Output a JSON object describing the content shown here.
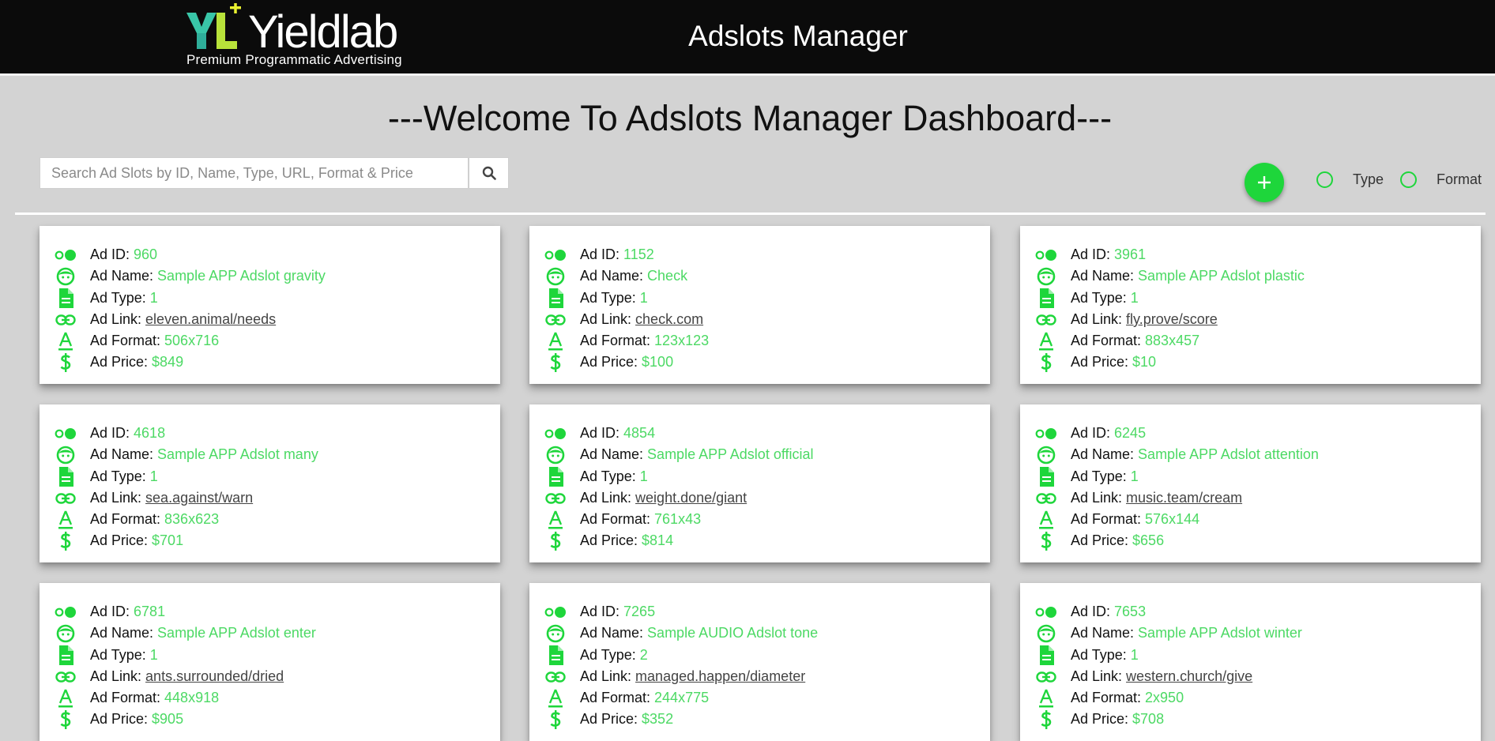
{
  "header": {
    "logo_wordmark": "Yieldlab",
    "logo_mark": "YL+",
    "logo_tagline": "Premium Programmatic Advertising",
    "title": "Adslots Manager"
  },
  "welcome_text": "---Welcome To Adslots Manager Dashboard---",
  "search": {
    "placeholder": "Search Ad Slots by ID, Name, Type, URL, Format & Price",
    "value": "",
    "icon": "search-icon"
  },
  "actions": {
    "add_label": "+",
    "add_icon": "plus-icon"
  },
  "filters": [
    {
      "label": "Type",
      "checked": false
    },
    {
      "label": "Format",
      "checked": false
    }
  ],
  "colors": {
    "accent": "#1ed63b",
    "value_text": "#4cd964",
    "header_bg": "#0b0b0b",
    "page_bg": "#d3d3d3"
  },
  "field_labels": {
    "id": "Ad ID:",
    "name": "Ad Name:",
    "type": "Ad Type:",
    "link": "Ad Link:",
    "format": "Ad Format:",
    "price": "Ad Price:"
  },
  "field_icons": {
    "id": "toggle-icon",
    "name": "face-icon",
    "type": "document-icon",
    "link": "link-icon",
    "format": "font-format-icon",
    "price": "dollar-icon"
  },
  "adslots": [
    {
      "id": "960",
      "name": "Sample APP Adslot gravity",
      "type": "1",
      "link": "eleven.animal/needs",
      "format": "506x716",
      "price": "$849"
    },
    {
      "id": "1152",
      "name": "Check",
      "type": "1",
      "link": "check.com",
      "format": "123x123",
      "price": "$100"
    },
    {
      "id": "3961",
      "name": "Sample APP Adslot plastic",
      "type": "1",
      "link": "fly.prove/score",
      "format": "883x457",
      "price": "$10"
    },
    {
      "id": "4618",
      "name": "Sample APP Adslot many",
      "type": "1",
      "link": "sea.against/warn",
      "format": "836x623",
      "price": "$701"
    },
    {
      "id": "4854",
      "name": "Sample APP Adslot official",
      "type": "1",
      "link": "weight.done/giant",
      "format": "761x43",
      "price": "$814"
    },
    {
      "id": "6245",
      "name": "Sample APP Adslot attention",
      "type": "1",
      "link": "music.team/cream",
      "format": "576x144",
      "price": "$656"
    },
    {
      "id": "6781",
      "name": "Sample APP Adslot enter",
      "type": "1",
      "link": "ants.surrounded/dried",
      "format": "448x918",
      "price": "$905"
    },
    {
      "id": "7265",
      "name": "Sample AUDIO Adslot tone",
      "type": "2",
      "link": "managed.happen/diameter",
      "format": "244x775",
      "price": "$352"
    },
    {
      "id": "7653",
      "name": "Sample APP Adslot winter",
      "type": "1",
      "link": "western.church/give",
      "format": "2x950",
      "price": "$708"
    }
  ]
}
